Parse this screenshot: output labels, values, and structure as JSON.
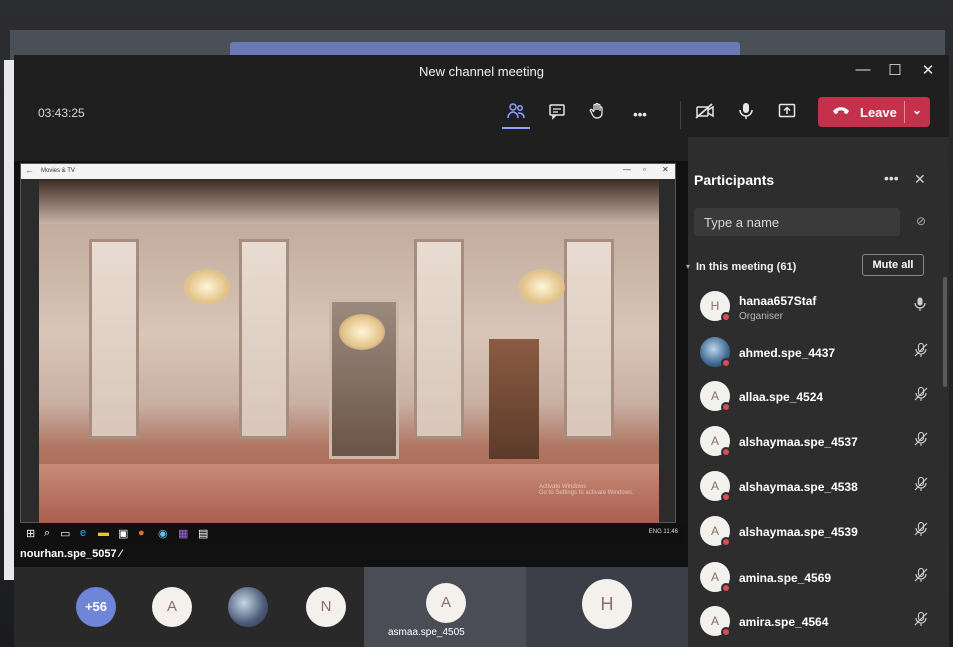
{
  "window": {
    "title": "New channel meeting",
    "minimize": "—",
    "maximize": "☐",
    "close": "✕"
  },
  "toolbar": {
    "timer": "03:43:25",
    "people_icon": "people-icon",
    "chat_icon": "chat-icon",
    "hand_icon": "raise-hand-icon",
    "more": "•••",
    "camera_icon": "camera-off-icon",
    "mic_icon": "microphone-icon",
    "share_icon": "share-screen-icon",
    "leave_label": "Leave",
    "leave_chevron": "⌄"
  },
  "shared_content": {
    "app_title": "Movies & TV",
    "watermark_line1": "Activate Windows",
    "watermark_line2": "Go to Settings to activate Windows.",
    "tray_time": "11:46",
    "tray_lang": "ENG",
    "presenter": "nourhan.spe_5057"
  },
  "gallery": {
    "more_count": "+56",
    "tiles": [
      "A",
      "N",
      "A",
      "H"
    ],
    "tile_label": "asmaa.spe_4505"
  },
  "participants": {
    "title": "Participants",
    "more": "•••",
    "close": "✕",
    "search_placeholder": "Type a name",
    "section_label": "In this meeting (61)",
    "mute_all": "Mute all",
    "people": [
      {
        "initial": "H",
        "name": "hanaa657Staf",
        "role": "Organiser",
        "mic": "🎙"
      },
      {
        "initial": "",
        "name": "ahmed.spe_4437",
        "role": "",
        "mic": "🎙̸"
      },
      {
        "initial": "A",
        "name": "allaa.spe_4524",
        "role": "",
        "mic": "🎙̸"
      },
      {
        "initial": "A",
        "name": "alshaymaa.spe_4537",
        "role": "",
        "mic": "🎙̸"
      },
      {
        "initial": "A",
        "name": "alshaymaa.spe_4538",
        "role": "",
        "mic": "🎙̸"
      },
      {
        "initial": "A",
        "name": "alshaymaa.spe_4539",
        "role": "",
        "mic": "🎙̸"
      },
      {
        "initial": "A",
        "name": "amina.spe_4569",
        "role": "",
        "mic": "🎙̸"
      },
      {
        "initial": "A",
        "name": "amira.spe_4564",
        "role": "",
        "mic": "🎙̸"
      }
    ]
  },
  "colors": {
    "leave": "#c4314b",
    "accent": "#8ea2ff",
    "panel": "#2d2d2d"
  }
}
